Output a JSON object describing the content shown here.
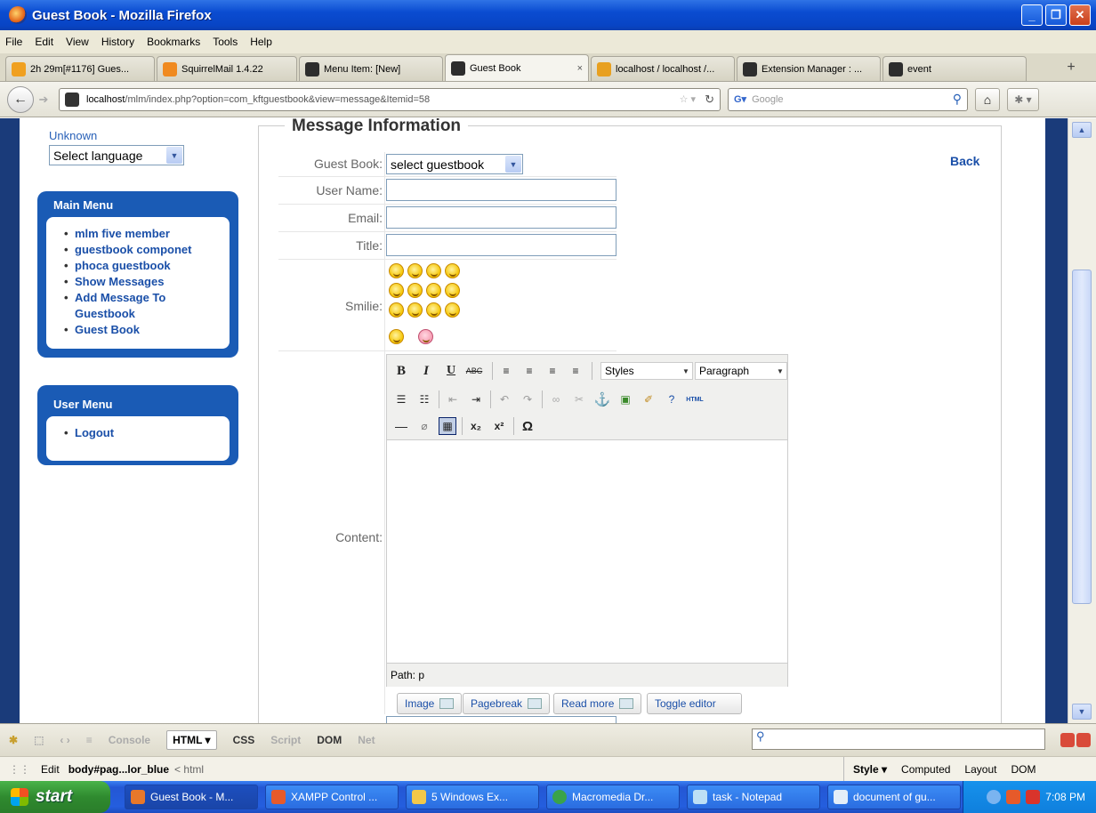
{
  "window": {
    "title": "Guest Book - Mozilla Firefox"
  },
  "menubar": [
    "File",
    "Edit",
    "View",
    "History",
    "Bookmarks",
    "Tools",
    "Help"
  ],
  "tabs": [
    {
      "label": "2h 29m[#1176] Gues...",
      "color": "#f0a020"
    },
    {
      "label": "SquirrelMail 1.4.22",
      "color": "#f08a20"
    },
    {
      "label": "Menu Item: [New]",
      "color": "#2d2d2d"
    },
    {
      "label": "Guest Book",
      "color": "#2d2d2d",
      "close": "×"
    },
    {
      "label": "localhost / localhost /...",
      "color": "#e8a020"
    },
    {
      "label": "Extension Manager : ...",
      "color": "#2d2d2d"
    },
    {
      "label": "event",
      "color": "#2d2d2d"
    }
  ],
  "nav": {
    "url_host": "localhost",
    "url_rest": "/mlm/index.php?option=com_kftguestbook&view=message&Itemid=58",
    "search_placeholder": "Google"
  },
  "sidebar": {
    "lang_label": "Unknown",
    "lang_select": "Select language",
    "main_menu": {
      "title": "Main Menu",
      "items": [
        "mlm five member",
        "guestbook componet",
        "phoca guestbook",
        "Show Messages",
        "Add Message To",
        "Guestbook",
        "Guest Book"
      ]
    },
    "user_menu": {
      "title": "User Menu",
      "items": [
        "Logout"
      ]
    }
  },
  "form": {
    "legend": "Message Information",
    "back": "Back",
    "guestbook_label": "Guest Book:",
    "guestbook_value": "select guestbook",
    "username_label": "User Name:",
    "email_label": "Email:",
    "title_label": "Title:",
    "smilie_label": "Smilie:",
    "content_label": "Content:"
  },
  "editor": {
    "styles": "Styles",
    "paragraph": "Paragraph",
    "html_btn": "HTML",
    "path": "Path: p",
    "buttons": [
      "Image",
      "Pagebreak",
      "Read more",
      "Toggle editor"
    ]
  },
  "firebug": {
    "tabs": [
      "Console",
      "HTML ▾",
      "CSS",
      "Script",
      "DOM",
      "Net"
    ],
    "edit": "Edit",
    "crumb": "body#pag...lor_blue",
    "crumb2": "< html",
    "side_tabs": [
      "Style ▾",
      "Computed",
      "Layout",
      "DOM"
    ]
  },
  "taskbar": {
    "start": "start",
    "tasks": [
      "Guest Book - M...",
      "XAMPP Control ...",
      "5 Windows Ex...",
      "Macromedia Dr...",
      "task - Notepad",
      "document of gu..."
    ],
    "clock": "7:08 PM"
  }
}
